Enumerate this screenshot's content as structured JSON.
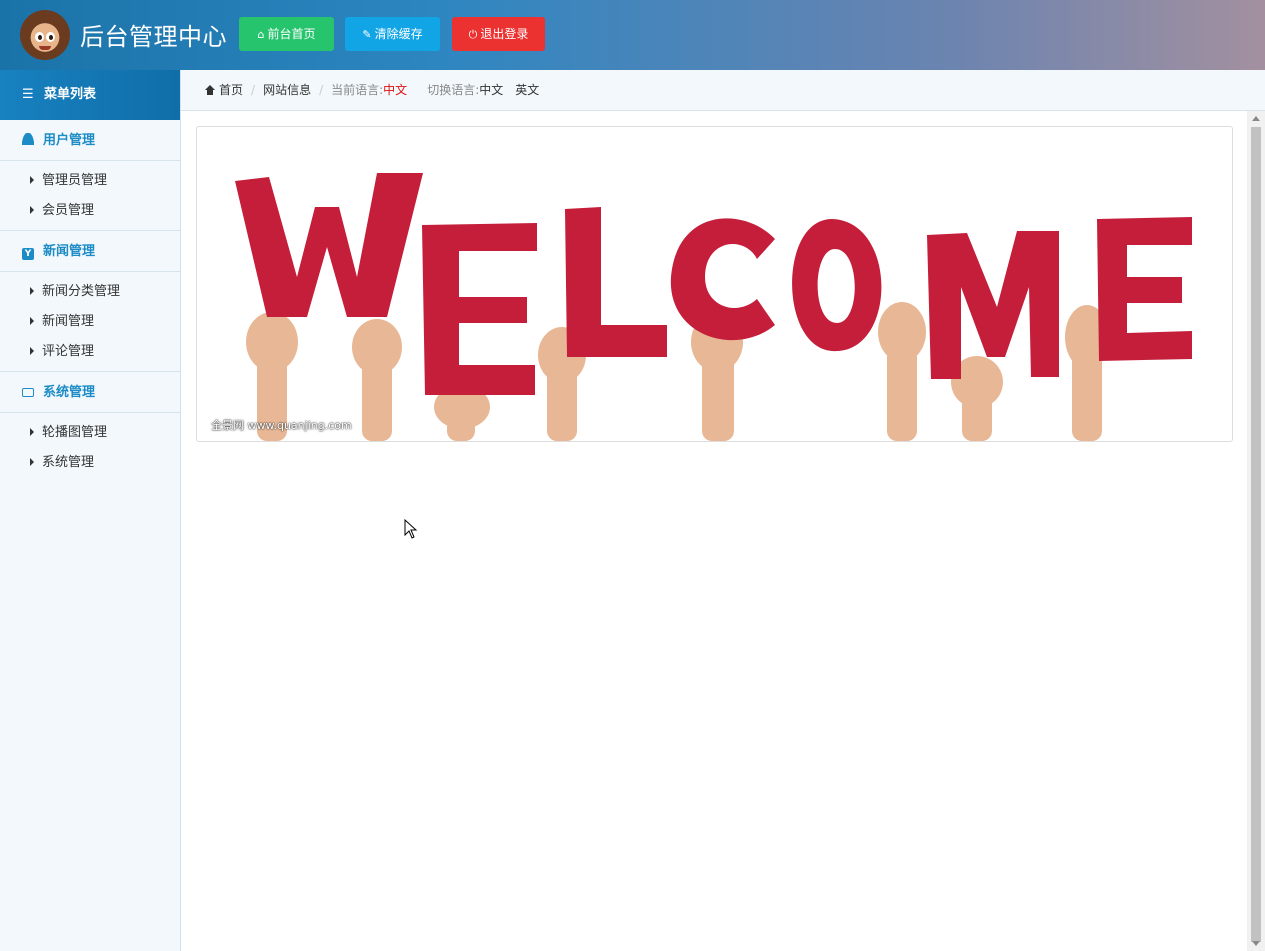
{
  "header": {
    "title": "后台管理中心",
    "buttons": {
      "home": "前台首页",
      "clear_cache": "清除缓存",
      "logout": "退出登录"
    }
  },
  "sidebar": {
    "heading": "菜单列表",
    "groups": [
      {
        "title": "用户管理",
        "icon": "user-icon",
        "items": [
          "管理员管理",
          "会员管理"
        ]
      },
      {
        "title": "新闻管理",
        "icon": "news-icon",
        "items": [
          "新闻分类管理",
          "新闻管理",
          "评论管理"
        ]
      },
      {
        "title": "系统管理",
        "icon": "system-icon",
        "items": [
          "轮播图管理",
          "系统管理"
        ]
      }
    ]
  },
  "breadcrumb": {
    "home": "首页",
    "site_info": "网站信息",
    "current_lang_label": "当前语言:",
    "current_lang": "中文",
    "switch_lang_label": "切换语言:",
    "lang_zh": "中文",
    "lang_en": "英文"
  },
  "banner": {
    "word": "WELCOME",
    "watermark": "全景网 www.quanjing.com",
    "letter_color": "#c41e3a"
  },
  "colors": {
    "header_start": "#1a73a8",
    "header_end": "#a3909f",
    "btn_home": "#27c46e",
    "btn_cache": "#12a5e6",
    "btn_logout": "#ec3131",
    "accent": "#1d8cc6"
  }
}
